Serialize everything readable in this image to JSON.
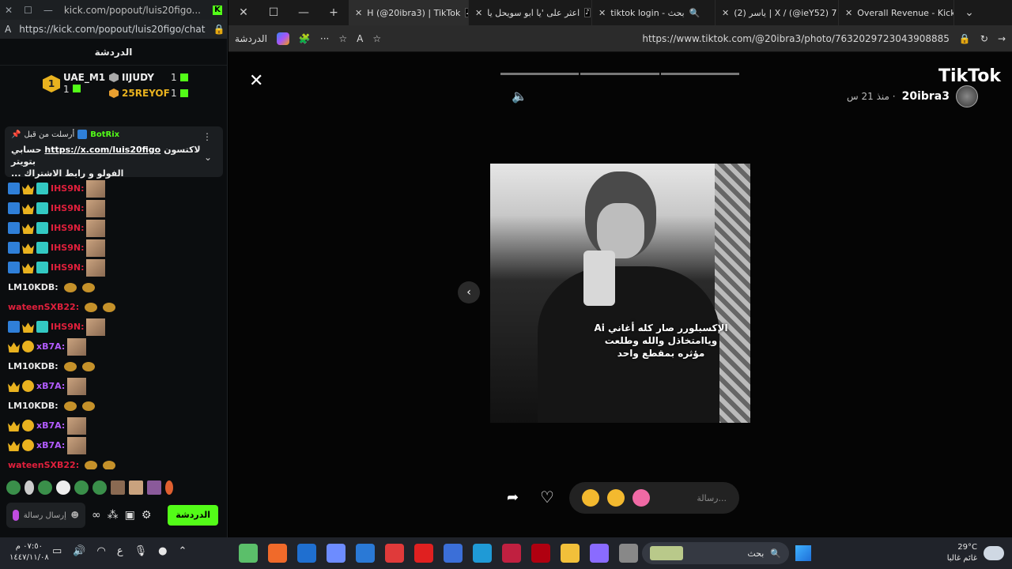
{
  "left_window": {
    "title": "kick.com/popout/luis20figo...",
    "url": "https://kick.com/popout/luis20figo/chat",
    "chat_header": "الدردشة",
    "leaderboard": [
      {
        "rank": "1",
        "name": "UAE_M1",
        "count": "1"
      },
      {
        "name": "IIJUDY",
        "count": "1"
      },
      {
        "name": "25REYOF",
        "count": "1"
      }
    ],
    "pinned": {
      "sent_by": "أرسلت من قبل",
      "bot": "BotRix",
      "text_prefix": "لاكتسون",
      "link": "https://x.com/luis20figo",
      "text_suffix": "حسابي بتويتر",
      "line2": "الفولو و رابط الاشتراك ..."
    },
    "messages": [
      {
        "user": "IHS9N:",
        "style": "red",
        "badges": "sub"
      },
      {
        "user": "IHS9N:",
        "style": "red",
        "badges": "sub"
      },
      {
        "user": "IHS9N:",
        "style": "red",
        "badges": "sub"
      },
      {
        "user": "IHS9N:",
        "style": "red",
        "badges": "sub"
      },
      {
        "user": "IHS9N:",
        "style": "red",
        "badges": "sub"
      },
      {
        "user": "LM10KDB:",
        "style": "white",
        "badges": "none"
      },
      {
        "user": "wateenSXB22:",
        "style": "red",
        "badges": "none"
      },
      {
        "user": "IHS9N:",
        "style": "red",
        "badges": "sub"
      },
      {
        "user": "xB7A:",
        "style": "purple",
        "badges": "coin"
      },
      {
        "user": "LM10KDB:",
        "style": "white",
        "badges": "none"
      },
      {
        "user": "xB7A:",
        "style": "purple",
        "badges": "coin"
      },
      {
        "user": "LM10KDB:",
        "style": "white",
        "badges": "none"
      },
      {
        "user": "xB7A:",
        "style": "purple",
        "badges": "coin"
      },
      {
        "user": "xB7A:",
        "style": "purple",
        "badges": "coin"
      },
      {
        "user": "wateenSXB22:",
        "style": "red",
        "badges": "none"
      }
    ],
    "input_placeholder": "إرسال رسالة",
    "send_button": "الدردشة"
  },
  "right_window": {
    "tabs": [
      {
        "label": "H (@20ibra3) | TikTok",
        "active": true
      },
      {
        "label": "اعثر على 'يا ابو سويحل يا"
      },
      {
        "label": "tiktok login - بحث"
      },
      {
        "label": "(2) ياسر | X / (@ieY52) 7"
      },
      {
        "label": "Overall Revenue - Kick D"
      }
    ],
    "url": "https://www.tiktok.com/@20ibra3/photo/7632029723043908885",
    "chat_label": "الدردشة",
    "logo": "TikTok",
    "author": "20ibra3",
    "time_ago": "· منذ 21 س",
    "caption": "الإكسبلورر صار كله أغاني Ai وياامتخاذل والله وطلعت مؤثره بمقطع واحد",
    "reply_placeholder": "رسالة..."
  },
  "taskbar": {
    "time": "٠٧:٥٠ م",
    "date": "١٤٤٧/١١/٠٨",
    "lang": "ع",
    "search": "بحث",
    "temperature": "29°C",
    "weather": "غائم غالبا"
  }
}
